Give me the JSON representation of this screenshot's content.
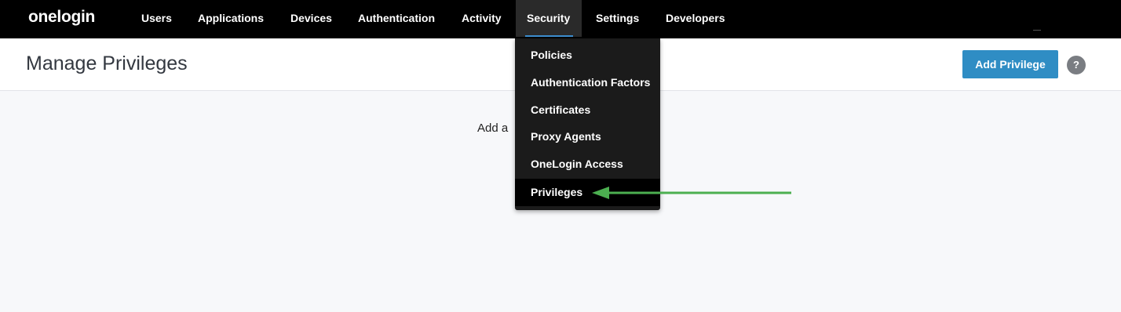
{
  "nav": {
    "logo": "onelogin",
    "items": [
      {
        "label": "Users"
      },
      {
        "label": "Applications"
      },
      {
        "label": "Devices"
      },
      {
        "label": "Authentication"
      },
      {
        "label": "Activity"
      },
      {
        "label": "Security"
      },
      {
        "label": "Settings"
      },
      {
        "label": "Developers"
      }
    ],
    "active": "Security"
  },
  "header": {
    "title": "Manage Privileges",
    "add_button": "Add Privilege",
    "help": "?"
  },
  "main": {
    "empty_text_partial": "Add a"
  },
  "security_menu": {
    "items": [
      {
        "label": "Policies"
      },
      {
        "label": "Authentication Factors"
      },
      {
        "label": "Certificates"
      },
      {
        "label": "Proxy Agents"
      },
      {
        "label": "OneLogin Access"
      },
      {
        "label": "Privileges"
      }
    ],
    "highlighted": "Privileges"
  },
  "colors": {
    "nav_bg": "#000000",
    "accent": "#2f8dc4",
    "active_underline": "#3d8fd1",
    "annotation_arrow": "#4caf50"
  }
}
